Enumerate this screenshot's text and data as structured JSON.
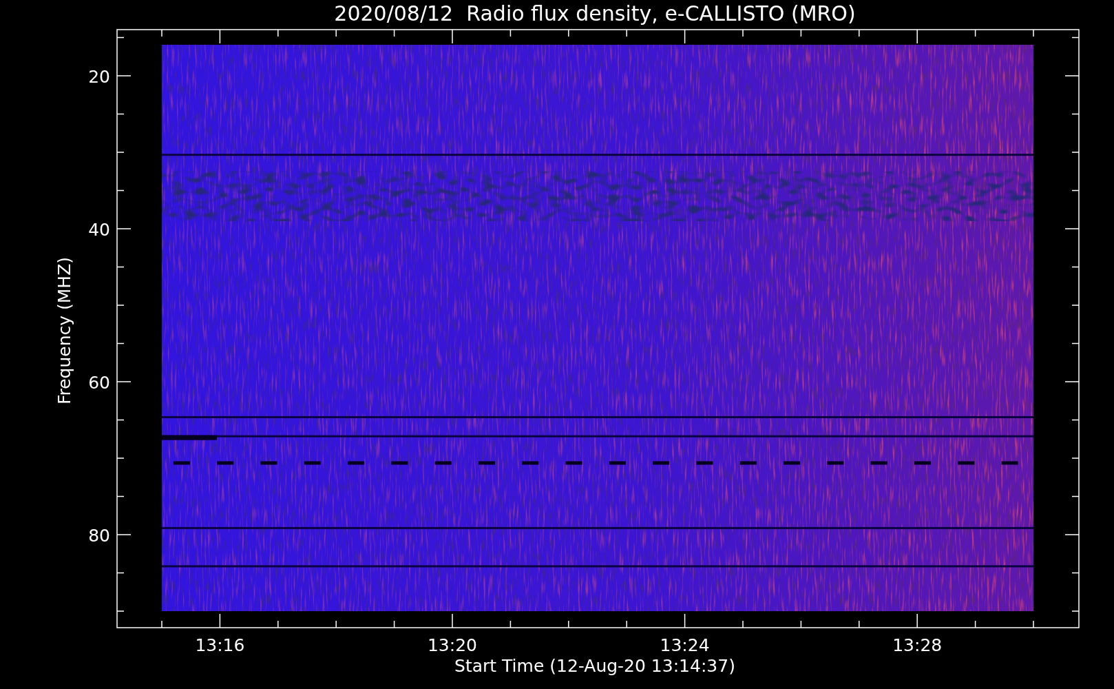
{
  "title": "2020/08/12  Radio flux density, e-CALLISTO (MRO)",
  "plot": {
    "ylabel": "Frequency (MHZ)",
    "xlabel": "Start Time (12-Aug-20 13:14:37)",
    "yticks": [
      "20",
      "40",
      "60",
      "80"
    ],
    "xticks": [
      "13:16",
      "13:20",
      "13:24",
      "13:28"
    ]
  }
}
